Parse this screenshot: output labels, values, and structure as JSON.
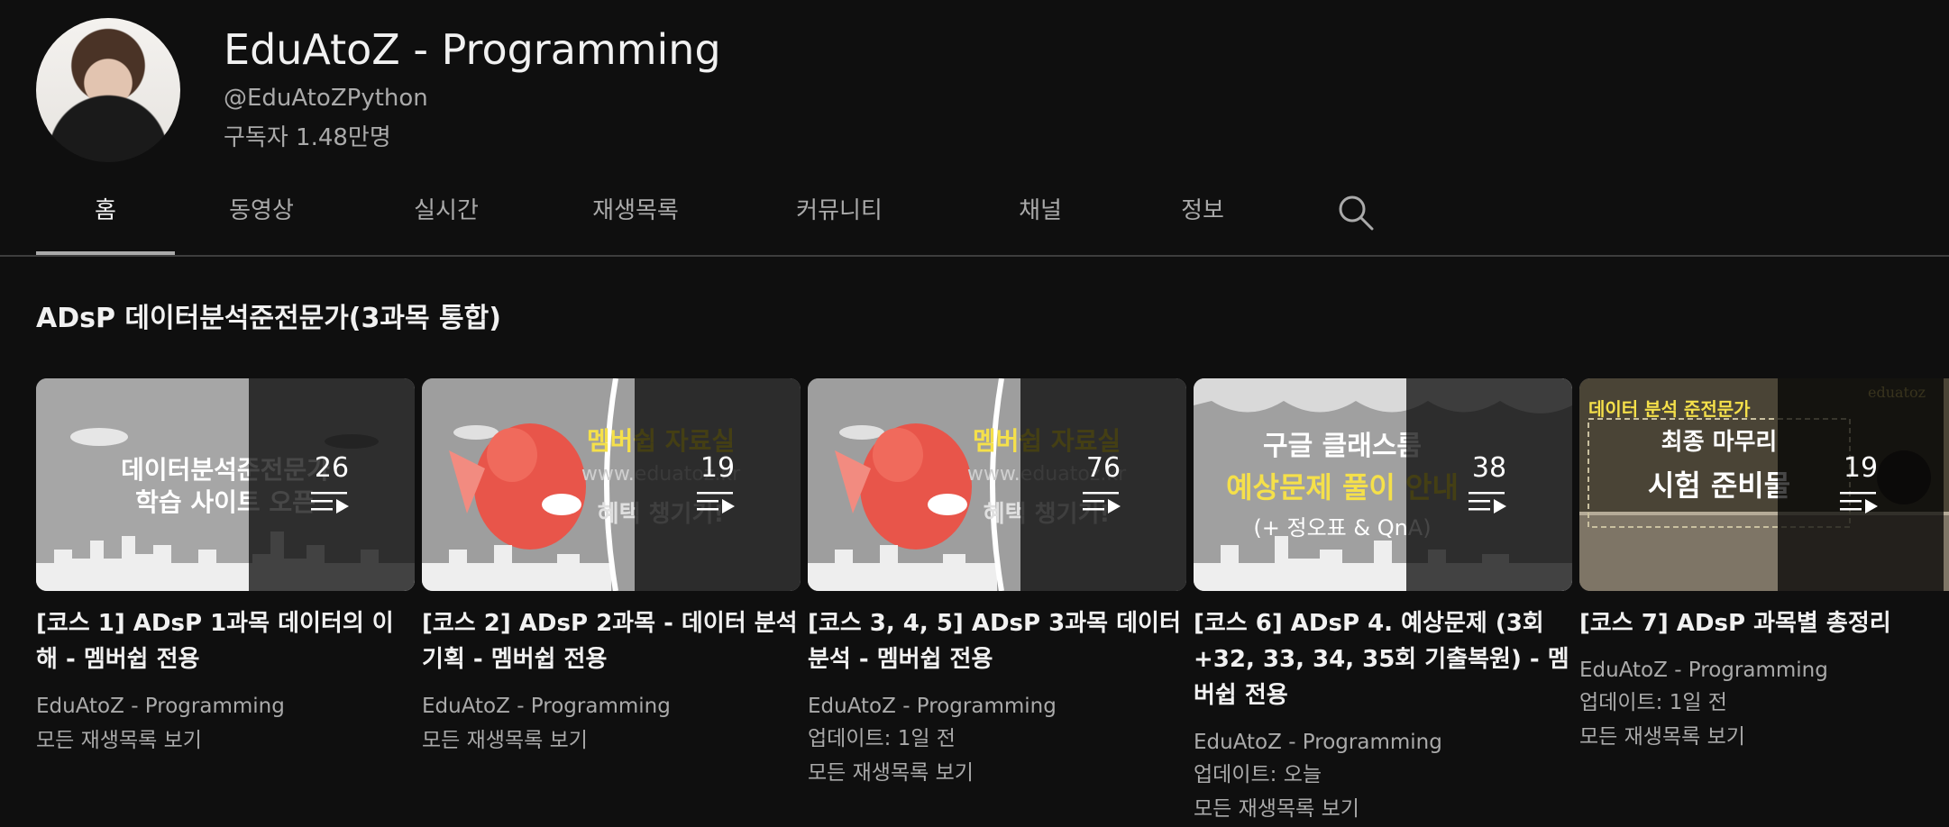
{
  "channel": {
    "title": "EduAtoZ - Programming",
    "handle": "@EduAtoZPython",
    "subscribers": "구독자 1.48만명"
  },
  "tabs": [
    {
      "label": "홈",
      "active": true
    },
    {
      "label": "동영상"
    },
    {
      "label": "실시간"
    },
    {
      "label": "재생목록"
    },
    {
      "label": "커뮤니티"
    },
    {
      "label": "채널"
    },
    {
      "label": "정보"
    }
  ],
  "search_icon": "search-icon",
  "shelf": {
    "title": "ADsP 데이터분석준전문가(3과목 통합)",
    "cards": [
      {
        "thumb_lines": [
          "데이터분석준전문가",
          "학습 사이트 오픈"
        ],
        "count": "26",
        "title": "[코스 1] ADsP 1과목 데이터의 이해 - 멤버쉽 전용",
        "channel": "EduAtoZ - Programming",
        "updated": "",
        "view_all": "모든 재생목록 보기"
      },
      {
        "thumb_lines": [
          "멤버쉽 자료실",
          "www.eduatoz.kr",
          "혜택 챙기기!"
        ],
        "count": "19",
        "title": "[코스 2] ADsP 2과목 - 데이터 분석 기획 - 멤버쉽 전용",
        "channel": "EduAtoZ - Programming",
        "updated": "",
        "view_all": "모든 재생목록 보기"
      },
      {
        "thumb_lines": [
          "멤버쉽 자료실",
          "www.eduatoz.kr",
          "혜택 챙기기!"
        ],
        "count": "76",
        "title": "[코스 3, 4, 5] ADsP 3과목 데이터 분석 - 멤버쉽 전용",
        "channel": "EduAtoZ - Programming",
        "updated": "업데이트: 1일 전",
        "view_all": "모든 재생목록 보기"
      },
      {
        "thumb_lines": [
          "구글 클래스룸",
          "예상문제 풀이 안내",
          "(+ 정오표 & QnA)"
        ],
        "count": "38",
        "title": "[코스 6] ADsP 4. 예상문제 (3회+32, 33, 34, 35회 기출복원) - 멤버쉽 전용",
        "channel": "EduAtoZ - Programming",
        "updated": "업데이트: 오늘",
        "view_all": "모든 재생목록 보기"
      },
      {
        "thumb_lines": [
          "데이터 분석 준전문가",
          "최종 마무리",
          "시험 준비물",
          "eduatoz"
        ],
        "count": "19",
        "title": "[코스 7] ADsP 과목별 총정리",
        "channel": "EduAtoZ - Programming",
        "updated": "업데이트: 1일 전",
        "view_all": "모든 재생목록 보기"
      }
    ]
  },
  "colors": {
    "background": "#0f0f0f",
    "text_primary": "#f1f1f1",
    "text_secondary": "#aaaaaa",
    "thumb_highlight": "#f5e04a"
  }
}
